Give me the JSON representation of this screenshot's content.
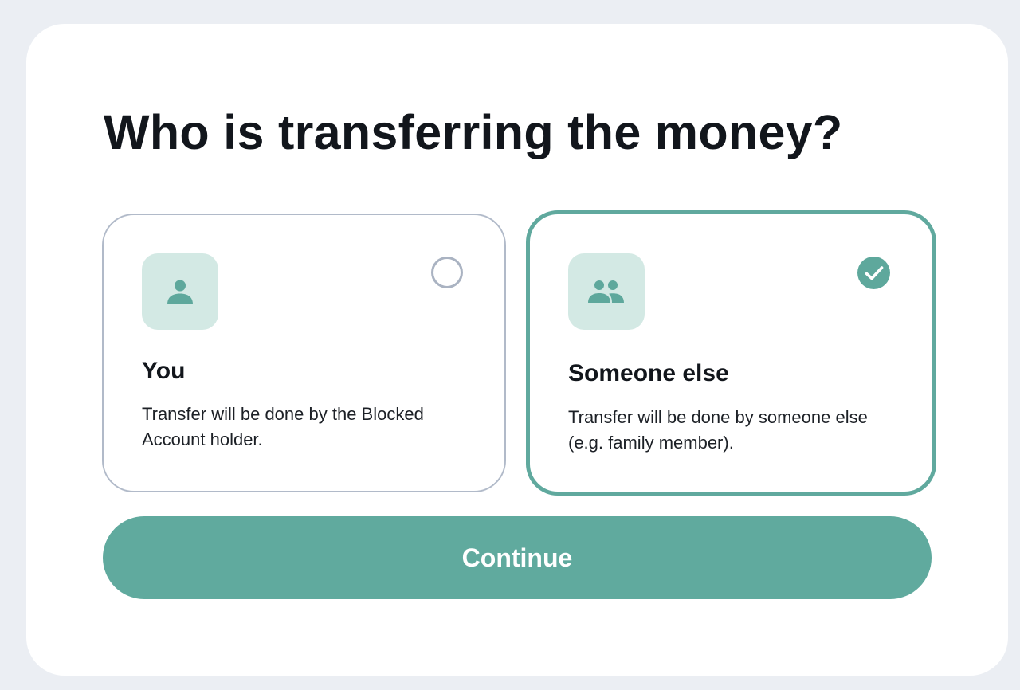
{
  "page": {
    "title": "Who is transferring the money?"
  },
  "options": [
    {
      "title": "You",
      "description": "Transfer will be done by the Blocked Account holder.",
      "icon": "person-icon",
      "selected": false
    },
    {
      "title": "Someone else",
      "description": "Transfer will be done by someone else (e.g. family member).",
      "icon": "people-icon",
      "selected": true
    }
  ],
  "actions": {
    "continue_label": "Continue"
  },
  "colors": {
    "accent": "#60aa9e",
    "icon_tile": "#d3e9e4",
    "card_border": "#b1bac9",
    "background": "#ebeef3",
    "text": "#12161c"
  }
}
